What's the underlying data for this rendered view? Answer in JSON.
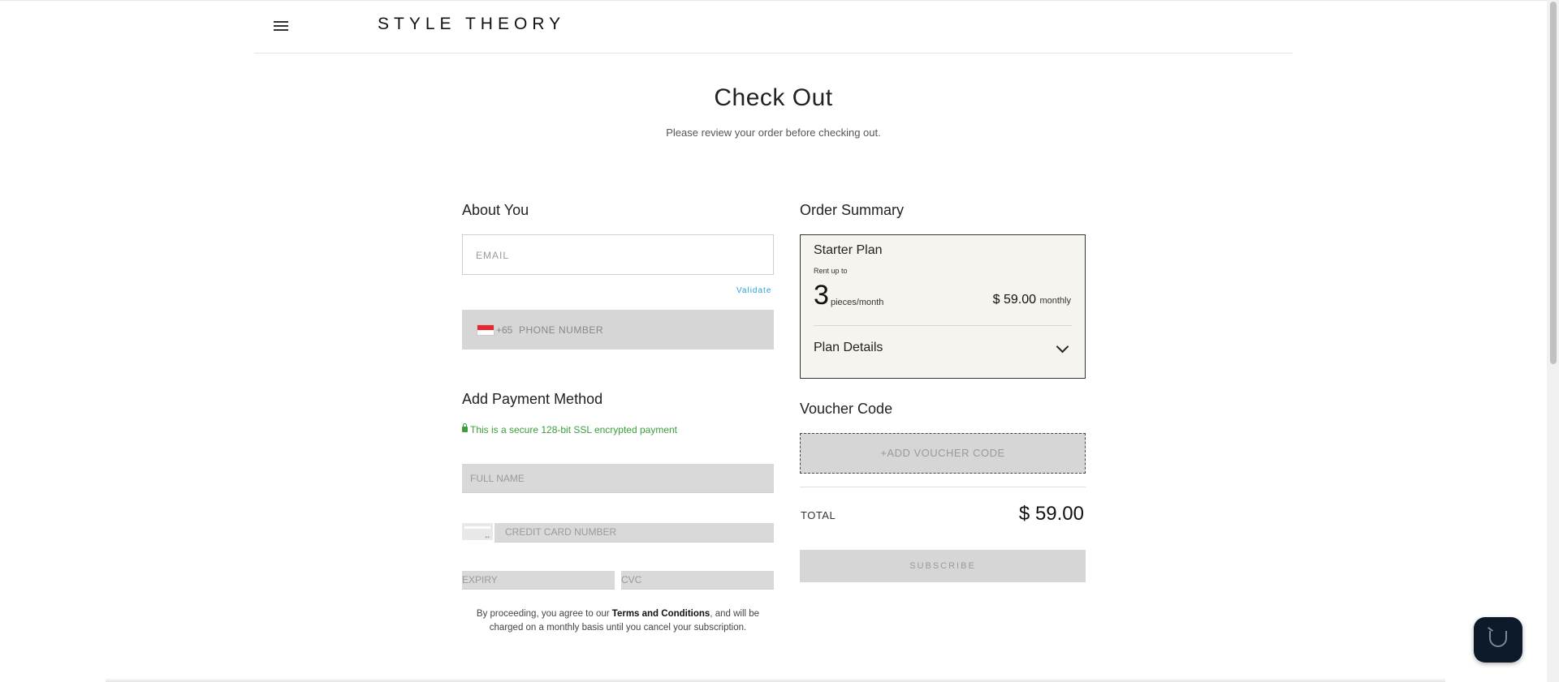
{
  "header": {
    "logo": "STYLE THEORY"
  },
  "page": {
    "title": "Check Out",
    "subtitle": "Please review your order before checking out."
  },
  "about": {
    "heading": "About You",
    "email_placeholder": "EMAIL",
    "validate_label": "Validate",
    "country_code": "+65",
    "phone_placeholder": "PHONE NUMBER"
  },
  "payment": {
    "heading": "Add Payment Method",
    "secure_text": "This is a secure 128-bit SSL encrypted payment",
    "full_name_placeholder": "FULL NAME",
    "card_number_placeholder": "CREDIT CARD NUMBER",
    "expiry_placeholder": "EXPIRY",
    "cvc_placeholder": "CVC"
  },
  "terms": {
    "prefix": "By proceeding, you agree to our ",
    "link": "Terms and Conditions",
    "suffix": ", and will be charged on a monthly basis until you cancel your subscription."
  },
  "summary": {
    "heading": "Order Summary",
    "plan_name": "Starter Plan",
    "rent_up_to": "Rent up to",
    "pieces_count": "3",
    "pieces_unit": "pieces/month",
    "price": "$ 59.00",
    "price_period": "monthly",
    "plan_details_label": "Plan Details"
  },
  "voucher": {
    "heading": "Voucher Code",
    "add_label": "+ADD VOUCHER CODE"
  },
  "total": {
    "label": "TOTAL",
    "value": "$ 59.00"
  },
  "subscribe_label": "SUBSCRIBE",
  "icons": {
    "menu": "hamburger-menu-icon",
    "flag": "singapore-flag-icon",
    "lock": "lock-icon",
    "card": "credit-card-icon",
    "chevron": "chevron-down-icon",
    "chat": "chat-widget-icon"
  },
  "colors": {
    "secure_green": "#3a9e3a",
    "validate_blue": "#2a9fd8",
    "summary_bg": "#f5f4ef",
    "disabled_gray": "#d6d6d6",
    "chat_bg": "#0d1a2a"
  }
}
